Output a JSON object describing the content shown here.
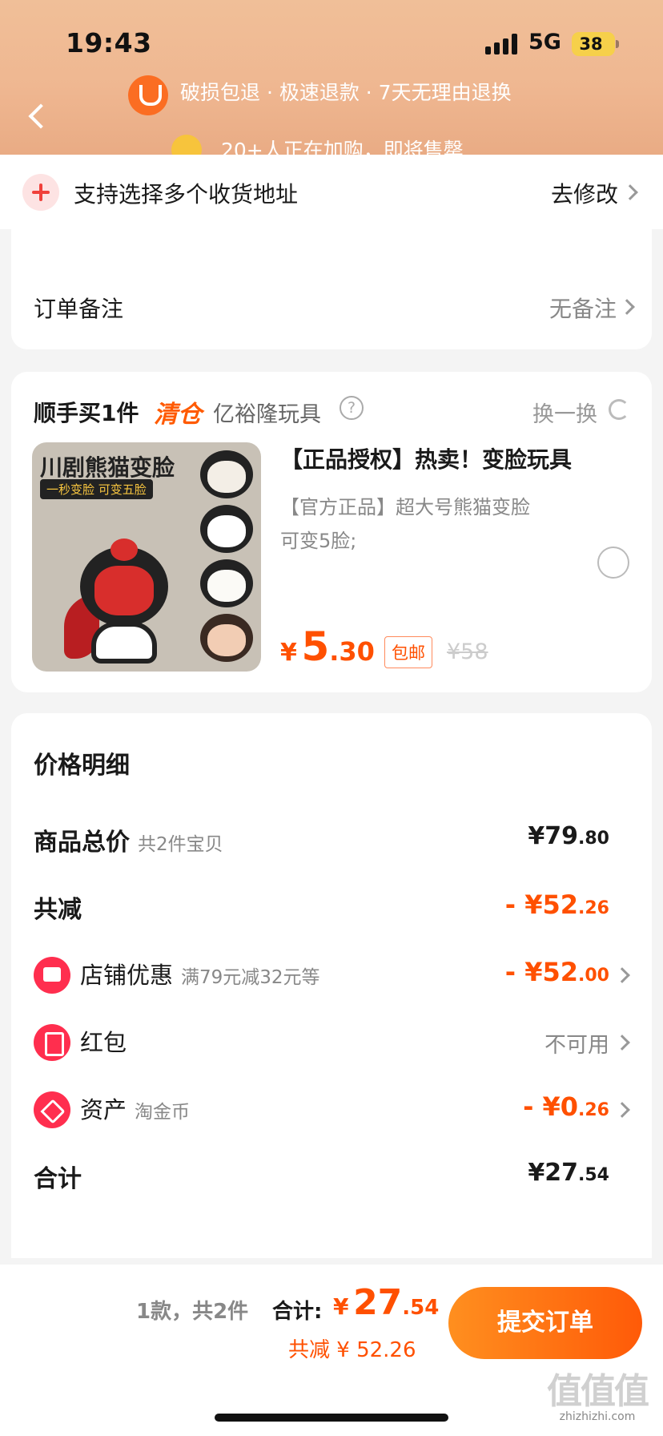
{
  "status": {
    "time": "19:43",
    "network": "5G",
    "battery": "38"
  },
  "header": {
    "guarantee_text": "破损包退 · 极速退款 · 7天无理由退换",
    "notice_text": "20+人正在加购，即将售罄"
  },
  "address": {
    "text": "支持选择多个收货地址",
    "action": "去修改"
  },
  "note": {
    "label": "订单备注",
    "value": "无备注"
  },
  "add_on": {
    "title": "顺手买1件",
    "tag": "清仓",
    "shop": "亿裕隆玩具",
    "swap_label": "换一换",
    "product": {
      "image_banner": "川剧熊猫变脸",
      "image_sub": "一秒变脸 可变五脸",
      "title": "【正品授权】热卖！变脸玩具",
      "desc": "【官方正品】超大号熊猫变脸可变5脸;",
      "price_symbol": "¥",
      "price_int": "5",
      "price_dec": ".30",
      "shipping": "包邮",
      "original_price": "¥58"
    }
  },
  "price_detail": {
    "title": "价格明细",
    "rows": [
      {
        "label": "商品总价",
        "sub": "共2件宝贝",
        "amount": "¥79",
        "amount_dec": ".80"
      },
      {
        "label": "共减",
        "sub": "",
        "amount": "- ¥52",
        "amount_dec": ".26"
      },
      {
        "label": "店铺优惠",
        "sub": "满79元减32元等",
        "amount": "- ¥52",
        "amount_dec": ".00"
      },
      {
        "label": "红包",
        "sub": "",
        "amount": "不可用",
        "amount_dec": ""
      },
      {
        "label": "资产",
        "sub": "淘金币",
        "amount": "- ¥0",
        "amount_dec": ".26"
      },
      {
        "label": "合计",
        "sub": "",
        "amount": "¥27",
        "amount_dec": ".54"
      }
    ]
  },
  "footer": {
    "count": "1款，共2件",
    "total_label": "合计:",
    "total_symbol": "¥",
    "total_int": "27",
    "total_dec": ".54",
    "discount": "共减 ¥ 52.26",
    "submit": "提交订单"
  },
  "watermark": {
    "logo": "值值值",
    "text": "zhizhizhi.com"
  },
  "colors": {
    "accent": "#ff5000",
    "header_bg": "#efb791",
    "button_start": "#ff8f1f",
    "button_end": "#ff5a08"
  }
}
